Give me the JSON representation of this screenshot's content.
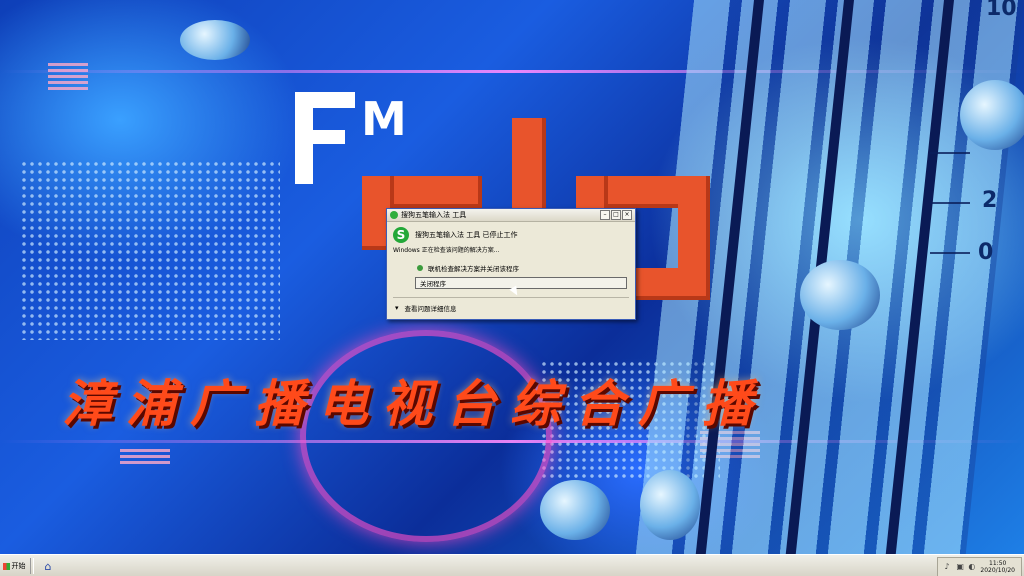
{
  "background": {
    "logo_letters": "FM",
    "banner_text": "漳浦广播电视台综合广播",
    "scale_labels": [
      "10",
      "2",
      "0"
    ],
    "colors": {
      "accent_red": "#e8542c",
      "banner_red": "#ff4a1a"
    }
  },
  "dialog": {
    "title": "搜狗五笔输入法 工具",
    "header_text": "搜狗五笔输入法 工具 已停止工作",
    "message": "Windows 正在检查该问题的解决方案...",
    "option_text": "联机检查解决方案并关闭该程序",
    "close_button_label": "关闭程序",
    "details_label": "查看问题详细信息",
    "app_icon": "sogou-s-icon",
    "window_buttons": [
      "minimize-icon",
      "maximize-icon",
      "close-icon"
    ]
  },
  "taskbar": {
    "start_label": "开始",
    "quick_launch_icon": "show-desktop-icon",
    "tray_icons": [
      "speaker-icon",
      "network-icon",
      "ime-icon"
    ],
    "clock_time": "11:50",
    "clock_date": "2020/10/20"
  }
}
